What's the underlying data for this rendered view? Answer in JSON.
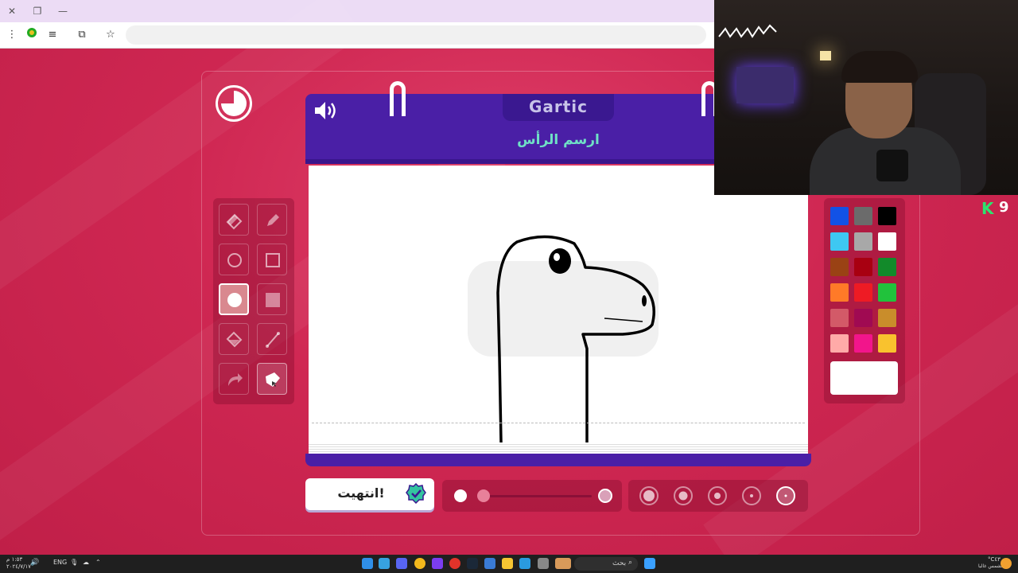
{
  "game": {
    "logo": "Gartic",
    "prompt": "ارسم الرأس",
    "done_button": "انتهيت!"
  },
  "palette": {
    "colors": [
      [
        "#1252e6",
        "#6b6b6b",
        "#000000"
      ],
      [
        "#3ec8f2",
        "#a8a8a8",
        "#ffffff"
      ],
      [
        "#9a4214",
        "#a80011",
        "#128a2a"
      ],
      [
        "#ff7a28",
        "#ee1b24",
        "#21c23c"
      ],
      [
        "#d35a68",
        "#a00a52",
        "#c98d2b"
      ],
      [
        "#ffaaa8",
        "#f2158b",
        "#f9c22e"
      ]
    ],
    "selected": "#ffffff"
  },
  "badge": {
    "letter": "K",
    "count": "9"
  },
  "taskbar": {
    "search_label": "بحث",
    "lang": "ENG",
    "weather": "°C٤٣",
    "weather_desc": "مشمس غالبا",
    "time": "١:٥٣ م",
    "date": "٢٠٢٤/٧/١٧"
  }
}
